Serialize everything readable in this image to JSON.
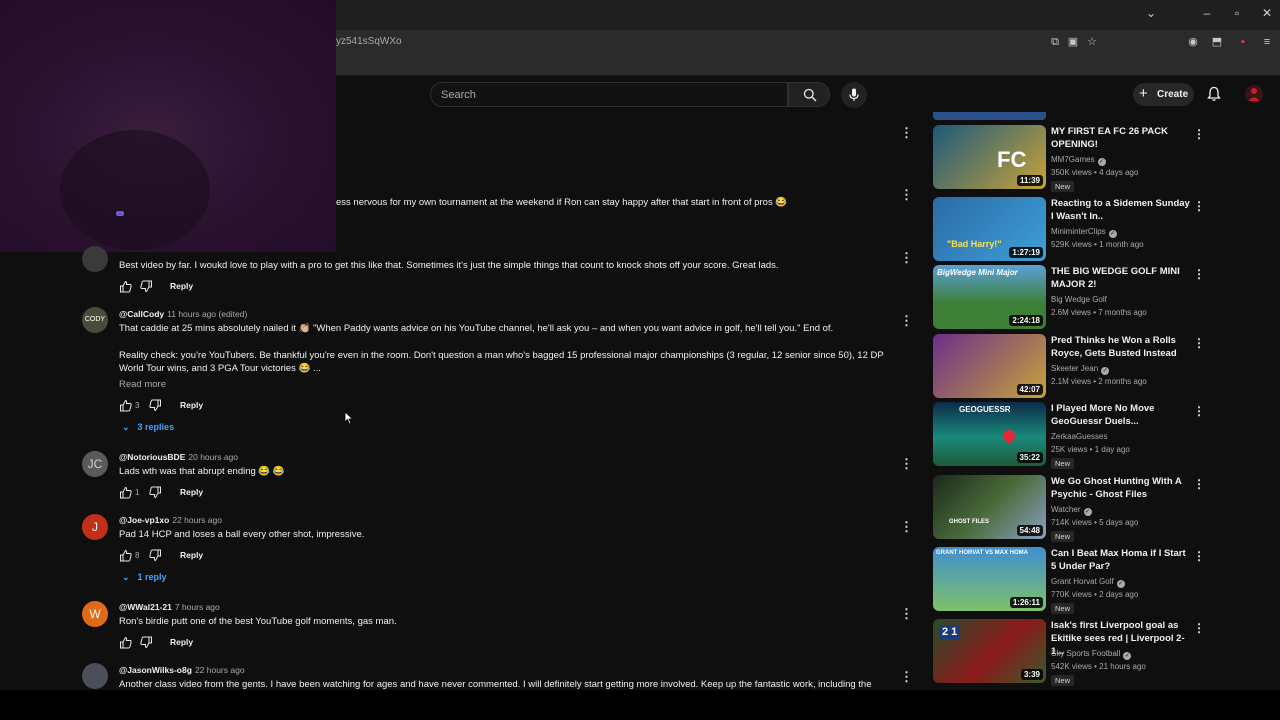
{
  "browser": {
    "url": "yz541sSqWXo"
  },
  "header": {
    "search_placeholder": "Search",
    "create_label": "Create"
  },
  "comments": [
    {
      "text": "ess nervous for my own tournament at the weekend if Ron can stay happy after that start in front of pros 😂"
    },
    {
      "text": "Best video by far. I woukd love to play with a pro to get this like that. Sometimes it's just the simple things that count to knock shots off your score. Great lads.",
      "reply": "Reply"
    },
    {
      "author": "@CallCody",
      "time": "11 hours ago (edited)",
      "text": "That caddie at 25 mins absolutely nailed it 👏🏼 \"When Paddy wants advice on his YouTube channel, he'll ask you – and when you want advice in golf, he'll tell you.\" End of.",
      "text2": "Reality check: you're YouTubers. Be thankful you're even in the room. Don't question a man who's bagged 15 professional major championships (3 regular, 12 senior since 50), 12 DP",
      "text3": "World Tour wins, and 3 PGA Tour victories 😂 ...",
      "read_more": "Read more",
      "likes": "3",
      "reply": "Reply",
      "replies": "3 replies"
    },
    {
      "author": "@NotoriousBDE",
      "time": "20 hours ago",
      "avatar": "JC",
      "text": "Lads wth was that abrupt ending 😂 😂",
      "likes": "1",
      "reply": "Reply"
    },
    {
      "author": "@Joe-vp1xo",
      "time": "22 hours ago",
      "avatar": "J",
      "text": "Pad 14 HCP and loses a ball every other shot, impressive.",
      "likes": "8",
      "reply": "Reply",
      "replies": "1 reply"
    },
    {
      "author": "@WWal21-21",
      "time": "7 hours ago",
      "avatar": "W",
      "text": "Ron's birdie putt one of the best YouTube golf moments, gas man.",
      "reply": "Reply"
    },
    {
      "author": "@JasonWilks-o8g",
      "time": "22 hours ago",
      "text": "Another class video from the gents. I have been watching for ages and have never commented. I will definitely start getting more involved. Keep up the fantastic work, including the"
    }
  ],
  "recommended": [
    {
      "title": "MY FIRST EA FC 26 PACK OPENING!",
      "channel": "MM7Games",
      "verified": true,
      "meta": "350K views • 4 days ago",
      "duration": "11:39",
      "new": "New",
      "thumb_color": "#1b5a7a"
    },
    {
      "title": "Reacting to a Sidemen Sunday I Wasn't In..",
      "channel": "MiniminterClips",
      "verified": true,
      "meta": "529K views • 1 month ago",
      "duration": "1:27:19",
      "thumb_color": "#2a6aa8",
      "thumb_text": "\"Bad Harry!\""
    },
    {
      "title": "THE BIG WEDGE GOLF MINI MAJOR 2!",
      "channel": "Big Wedge Golf",
      "verified": false,
      "meta": "2.6M views • 7 months ago",
      "duration": "2:24:18",
      "thumb_color": "#3e7f38",
      "thumb_text": "BigWedge Mini Major"
    },
    {
      "title": "Pred Thinks he Won a Rolls Royce, Gets Busted Instead",
      "channel": "Skeeter Jean",
      "verified": true,
      "meta": "2.1M views • 2 months ago",
      "duration": "42:07",
      "thumb_color": "#6b2f8a"
    },
    {
      "title": "I Played More No Move GeoGuessr Duels...",
      "channel": "ZerkaaGuesses",
      "verified": false,
      "meta": "25K views • 1 day ago",
      "duration": "35:22",
      "new": "New",
      "thumb_color": "#1a8a7a",
      "thumb_text": "GEOGUESSR"
    },
    {
      "title": "We Go Ghost Hunting With A Psychic - Ghost Files",
      "channel": "Watcher",
      "verified": true,
      "meta": "714K views • 5 days ago",
      "duration": "54:48",
      "new": "New",
      "thumb_color": "#2f4a2a",
      "thumb_text": "GHOST FILES"
    },
    {
      "title": "Can I Beat Max Homa if I Start 5 Under Par?",
      "channel": "Grant Horvat Golf",
      "verified": true,
      "meta": "770K views • 2 days ago",
      "duration": "1:26:11",
      "new": "New",
      "thumb_color": "#3f8fd0",
      "thumb_text": "GRANT HORVAT VS MAX HOMA"
    },
    {
      "title": "Isak's first Liverpool goal as Ekitike sees red | Liverpool 2-1...",
      "channel": "Sky Sports Football",
      "verified": true,
      "meta": "542K views • 21 hours ago",
      "duration": "3:39",
      "new": "New",
      "thumb_color": "#8a1a1a",
      "thumb_text": "2 1"
    }
  ],
  "colors": {
    "background": "#0f0f0f",
    "link_blue": "#3ea6ff",
    "avatar_jc": "#5a5a5a",
    "avatar_j": "#c1311a",
    "avatar_w": "#e06a17"
  }
}
